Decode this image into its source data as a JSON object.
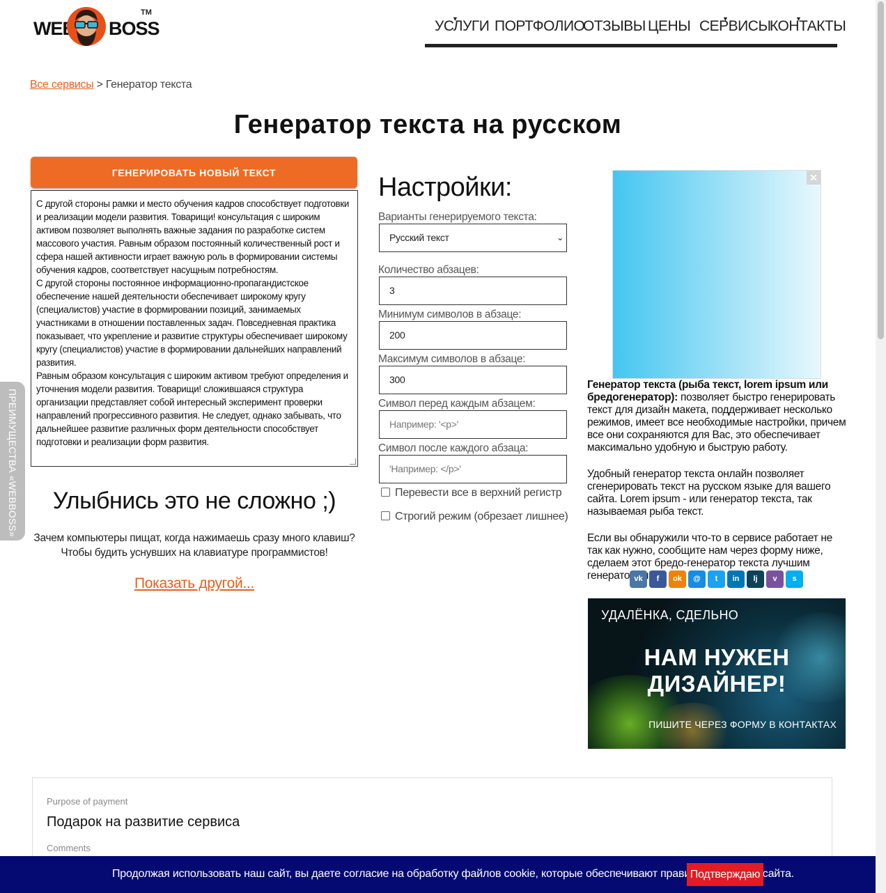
{
  "logo": {
    "left": "WEB",
    "right": "BOSS",
    "tm": "TM"
  },
  "nav": [
    {
      "label": "УСЛУГИ",
      "has_dropdown": true
    },
    {
      "label": "ПОРТФОЛИО",
      "has_dropdown": false
    },
    {
      "label": "ОТЗЫВЫ",
      "has_dropdown": false
    },
    {
      "label": "ЦЕНЫ",
      "has_dropdown": false
    },
    {
      "label": "СЕРВИСЫ",
      "has_dropdown": true
    },
    {
      "label": "КОНТАКТЫ",
      "has_dropdown": true
    }
  ],
  "side_tab": "ПРЕИМУЩЕСТВА «WEBBOSS»",
  "breadcrumb": {
    "link": "Все сервисы",
    "separator": ">",
    "current": "Генератор текста"
  },
  "page_title": "Генератор текста на русском",
  "generate_button": "ГЕНЕРИРОВАТЬ НОВЫЙ ТЕКСТ",
  "generated_paragraphs": [
    "С другой стороны рамки и место обучения кадров способствует подготовки и реализации модели развития. Товарищи! консультация с широким активом позволяет выполнять важные задания по разработке систем массового участия. Равным образом постоянный количественный рост и сфера нашей активности играет важную роль в формировании системы обучения кадров, соответствует насущным потребностям.",
    "С другой стороны постоянное информационно-пропагандистское обеспечение нашей деятельности обеспечивает широкому кругу (специалистов) участие в формировании позиций, занимаемых участниками в отношении поставленных задач. Повседневная практика показывает, что укрепление и развитие структуры обеспечивает широкому кругу (специалистов) участие в формировании дальнейших направлений развития.",
    "Равным образом консультация с широким активом требуют определения и уточнения модели развития. Товарищи! сложившаяся структура организации представляет собой интересный эксперимент проверки направлений прогрессивного развития. Не следует, однако забывать, что дальнейшее развитие различных форм деятельности способствует подготовки и реализации форм развития."
  ],
  "joke": {
    "title": "Улыбнись это не сложно ;)",
    "text": "Зачем компьютеры пищат, когда нажимаешь сразу много клавиш? Чтобы будить уснувших на клавиатуре программистов!",
    "link": "Показать другой..."
  },
  "settings": {
    "title": "Настройки:",
    "variant_label": "Варианты генерируемого текста:",
    "variant_value": "Русский текст",
    "paragraphs_label": "Количество абзацев:",
    "paragraphs_value": "3",
    "min_label": "Минимум символов в абзаце:",
    "min_value": "200",
    "max_label": "Максимум символов в абзаце:",
    "max_value": "300",
    "before_label": "Символ перед каждым абзацем:",
    "before_placeholder": "Например: '<p>'",
    "after_label": "Символ после каждого абзаца:",
    "after_placeholder": "'Например: </p>'",
    "uppercase_label": "Перевести все в верхний регистр",
    "strict_label": "Строгий режим (обрезает лишнее)"
  },
  "ad_close": "✕",
  "info": {
    "bold": "Генератор текста (рыба текст, lorem ipsum или бредогенератор):",
    "p1_rest": " позволяет быстро генерировать текст для дизайн макета, поддерживает несколько режимов, имеет все необходимые настройки, причем все они сохраняются для Вас, это обеспечивает максимально удобную и быструю работу.",
    "p2": "Удобный генератор текста онлайн позволяет сгенерировать текст на русском языке для вашего сайта. Lorem ipsum - или генератор текста, так называемая рыба текст.",
    "p3": "Если вы обнаружили что-то в сервисе работает не так как нужно, сообщите нам через форму ниже, сделаем этот бредо-генератор текста лучшим генератором!!!"
  },
  "share": [
    {
      "icon": "vk-icon",
      "glyph": "vk",
      "color": "#4a76a8"
    },
    {
      "icon": "facebook-icon",
      "glyph": "f",
      "color": "#3b5998"
    },
    {
      "icon": "odnoklassniki-icon",
      "glyph": "ok",
      "color": "#ee8208"
    },
    {
      "icon": "moimir-icon",
      "glyph": "@",
      "color": "#168de2"
    },
    {
      "icon": "twitter-icon",
      "glyph": "t",
      "color": "#1da1f2"
    },
    {
      "icon": "linkedin-icon",
      "glyph": "in",
      "color": "#0077b5"
    },
    {
      "icon": "livejournal-icon",
      "glyph": "lj",
      "color": "#0d425a"
    },
    {
      "icon": "viber-icon",
      "glyph": "v",
      "color": "#7b519d"
    },
    {
      "icon": "skype-icon",
      "glyph": "s",
      "color": "#00aff0"
    }
  ],
  "banner": {
    "top": "УДАЛЁНКА, СДЕЛЬНО",
    "line1": "НАМ НУЖЕН",
    "line2": "ДИЗАЙНЕР!",
    "bottom": "ПИШИТЕ ЧЕРЕЗ ФОРМУ В КОНТАКТАХ"
  },
  "payment": {
    "purpose_label": "Purpose of payment",
    "purpose_value": "Подарок на развитие сервиса",
    "comments_label": "Comments"
  },
  "cookie": {
    "text": "Продолжая использовать наш сайт, вы даете согласие на обработку файлов cookie, которые обеспечивают правильную работу сайта.",
    "button": "Подтверждаю"
  },
  "colors": {
    "accent": "#ee6b25",
    "cookie_bg": "#050a72",
    "cookie_button": "#e31b23"
  }
}
